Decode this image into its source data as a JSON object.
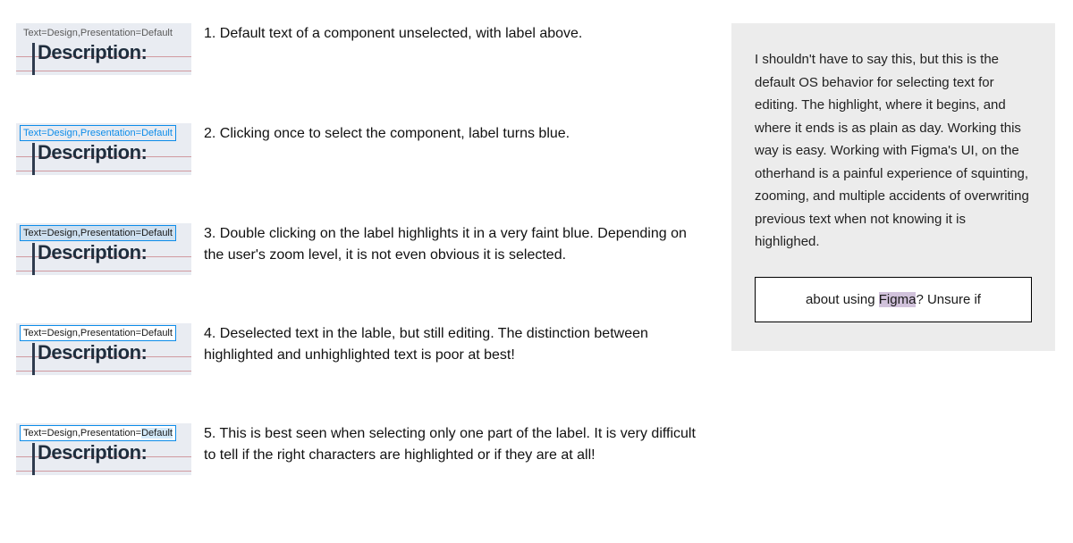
{
  "thumb": {
    "label": "Text=Design,Presentation=Default",
    "label_prefix": "Text=Design,Presentation=",
    "label_hl": "Default",
    "description": "Description:"
  },
  "captions": {
    "c1": "1. Default text of a component unselected, with label above.",
    "c2": "2. Clicking once to select the component, label turns blue.",
    "c3": "3. Double clicking on the label highlights it in a very faint blue. Depending on the user's zoom level, it is not even obvious it is selected.",
    "c4": "4. Deselected text in the lable, but still editing. The distinction between highlighted and unhighlighted text is poor at best!",
    "c5": "5. This is best seen when selecting only one part of the label. It is very difficult to tell if the right characters are highlighted or if they are at all!"
  },
  "side": {
    "para": "I shouldn't have to say this, but this is the default OS behavior for selecting text for editing. The highlight, where it begins, and where it ends is as plain as day. Working this way is easy. Working with Figma's UI, on the otherhand is a painful experience of squinting, zooming, and multiple accidents of overwriting previous text when not knowing it is highlighed.",
    "example_pre": "about using ",
    "example_sel": "Figma",
    "example_post": "? Unsure if "
  }
}
